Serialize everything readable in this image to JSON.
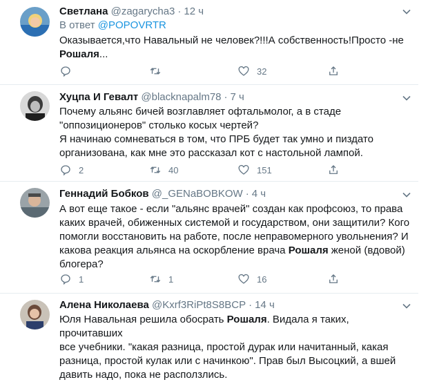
{
  "tweets": [
    {
      "name": "Светлана",
      "handle": "@zagarycha3",
      "time": "12 ч",
      "reply_prefix": "В ответ",
      "reply_target": "@POPOVRTR",
      "line1": "Оказывается,что Навальный не человек?!!!А собственность!Просто -не",
      "line2_bold": "Рошаля",
      "line2_rest": "...",
      "replies": "",
      "retweets": "",
      "likes": "32"
    },
    {
      "name": "Хуцпа И Гевалт",
      "handle": "@blacknapalm78",
      "time": "7 ч",
      "lines": [
        "Почему альянс бичей возглавляет офтальмолог, а в стаде",
        "\"оппозиционеров\" столько косых чертей?",
        "Я начинаю сомневаться в том, что ПРБ будет так умно и пиздато",
        "организована, как мне это рассказал кот с настольной лампой."
      ],
      "replies": "2",
      "retweets": "40",
      "likes": "151"
    },
    {
      "name": "Геннадий Бобков",
      "handle": "@_GENaBOBKOW",
      "time": "4 ч",
      "lines": [
        "А вот еще такое - если \"альянс врачей\" создан как профсоюз, то права",
        "каких врачей, обиженных системой и государством, они защитили? Кого",
        "помогли восстановить на работе, после неправомерного увольнения? И"
      ],
      "line4_pre": "какова реакция альянса на оскорбление врача ",
      "line4_bold": "Рошаля",
      "line4_post": " женой (вдовой)",
      "line5": "блогера?",
      "replies": "1",
      "retweets": "1",
      "likes": "16"
    },
    {
      "name": "Алена Николаева",
      "handle": "@Kxrf3RiPt8S8BCP",
      "time": "14 ч",
      "line1_pre": "Юля Навальная решила обосрать ",
      "line1_bold": "Рошаля",
      "line1_post": ". Видала я таких, прочитавших",
      "lines": [
        "все учебники. \"какая разница, простой дурак или начитанный, какая",
        "разница, простой кулак или с начинкою\". Прав был Высоцкий, а вшей",
        "давить надо, пока не расползлись."
      ]
    }
  ],
  "icons": {
    "reply": "reply-icon",
    "retweet": "retweet-icon",
    "like": "like-icon",
    "share": "share-icon",
    "more": "chevron-down-icon"
  }
}
